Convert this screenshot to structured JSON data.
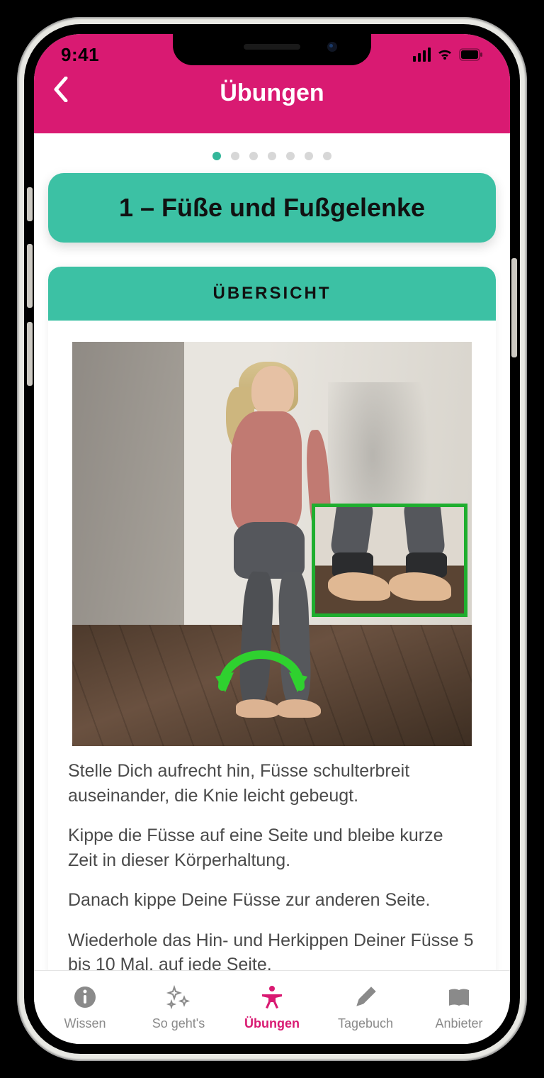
{
  "status": {
    "time": "9:41"
  },
  "header": {
    "title": "Übungen"
  },
  "pager": {
    "pages": 7,
    "current": 0
  },
  "exercise": {
    "title": "1 – Füße und Fußgelenke",
    "overview_label": "ÜBERSICHT",
    "paragraphs": [
      "Stelle Dich aufrecht hin, Füsse schulterbreit auseinander, die Knie leicht gebeugt.",
      "Kippe die Füsse auf eine Seite und bleibe kurze Zeit in dieser Körperhaltung.",
      "Danach kippe Deine Füsse zur anderen Seite.",
      "Wiederhole das Hin- und Herkippen Deiner Füsse 5 bis 10 Mal, auf jede Seite."
    ]
  },
  "tabs": [
    {
      "label": "Wissen",
      "icon": "info"
    },
    {
      "label": "So geht's",
      "icon": "sparkle"
    },
    {
      "label": "Übungen",
      "icon": "body",
      "active": true
    },
    {
      "label": "Tagebuch",
      "icon": "pencil"
    },
    {
      "label": "Anbieter",
      "icon": "book"
    }
  ]
}
